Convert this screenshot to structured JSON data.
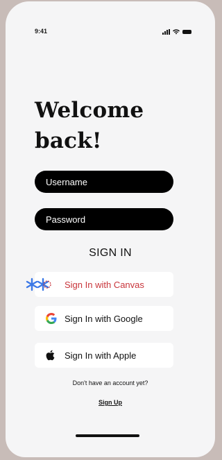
{
  "status_bar": {
    "time": "9:41"
  },
  "title": "Welcome back!",
  "form": {
    "username_placeholder": "Username",
    "password_placeholder": "Password",
    "submit_label": "SIGN IN"
  },
  "providers": [
    {
      "label": "Sign In with Canvas",
      "icon": "canvas-icon",
      "color": "#c8343a"
    },
    {
      "label": "Sign In with Google",
      "icon": "google-icon"
    },
    {
      "label": "Sign In with Apple",
      "icon": "apple-icon"
    }
  ],
  "footer": {
    "prompt": "Don't have an account yet?",
    "signup_label": "Sign Up"
  },
  "colors": {
    "background": "#c8bcb8",
    "screen": "#f5f5f6",
    "field": "#000000",
    "canvas_brand": "#c8343a",
    "canvas_icon_blue": "#3b78e7"
  }
}
